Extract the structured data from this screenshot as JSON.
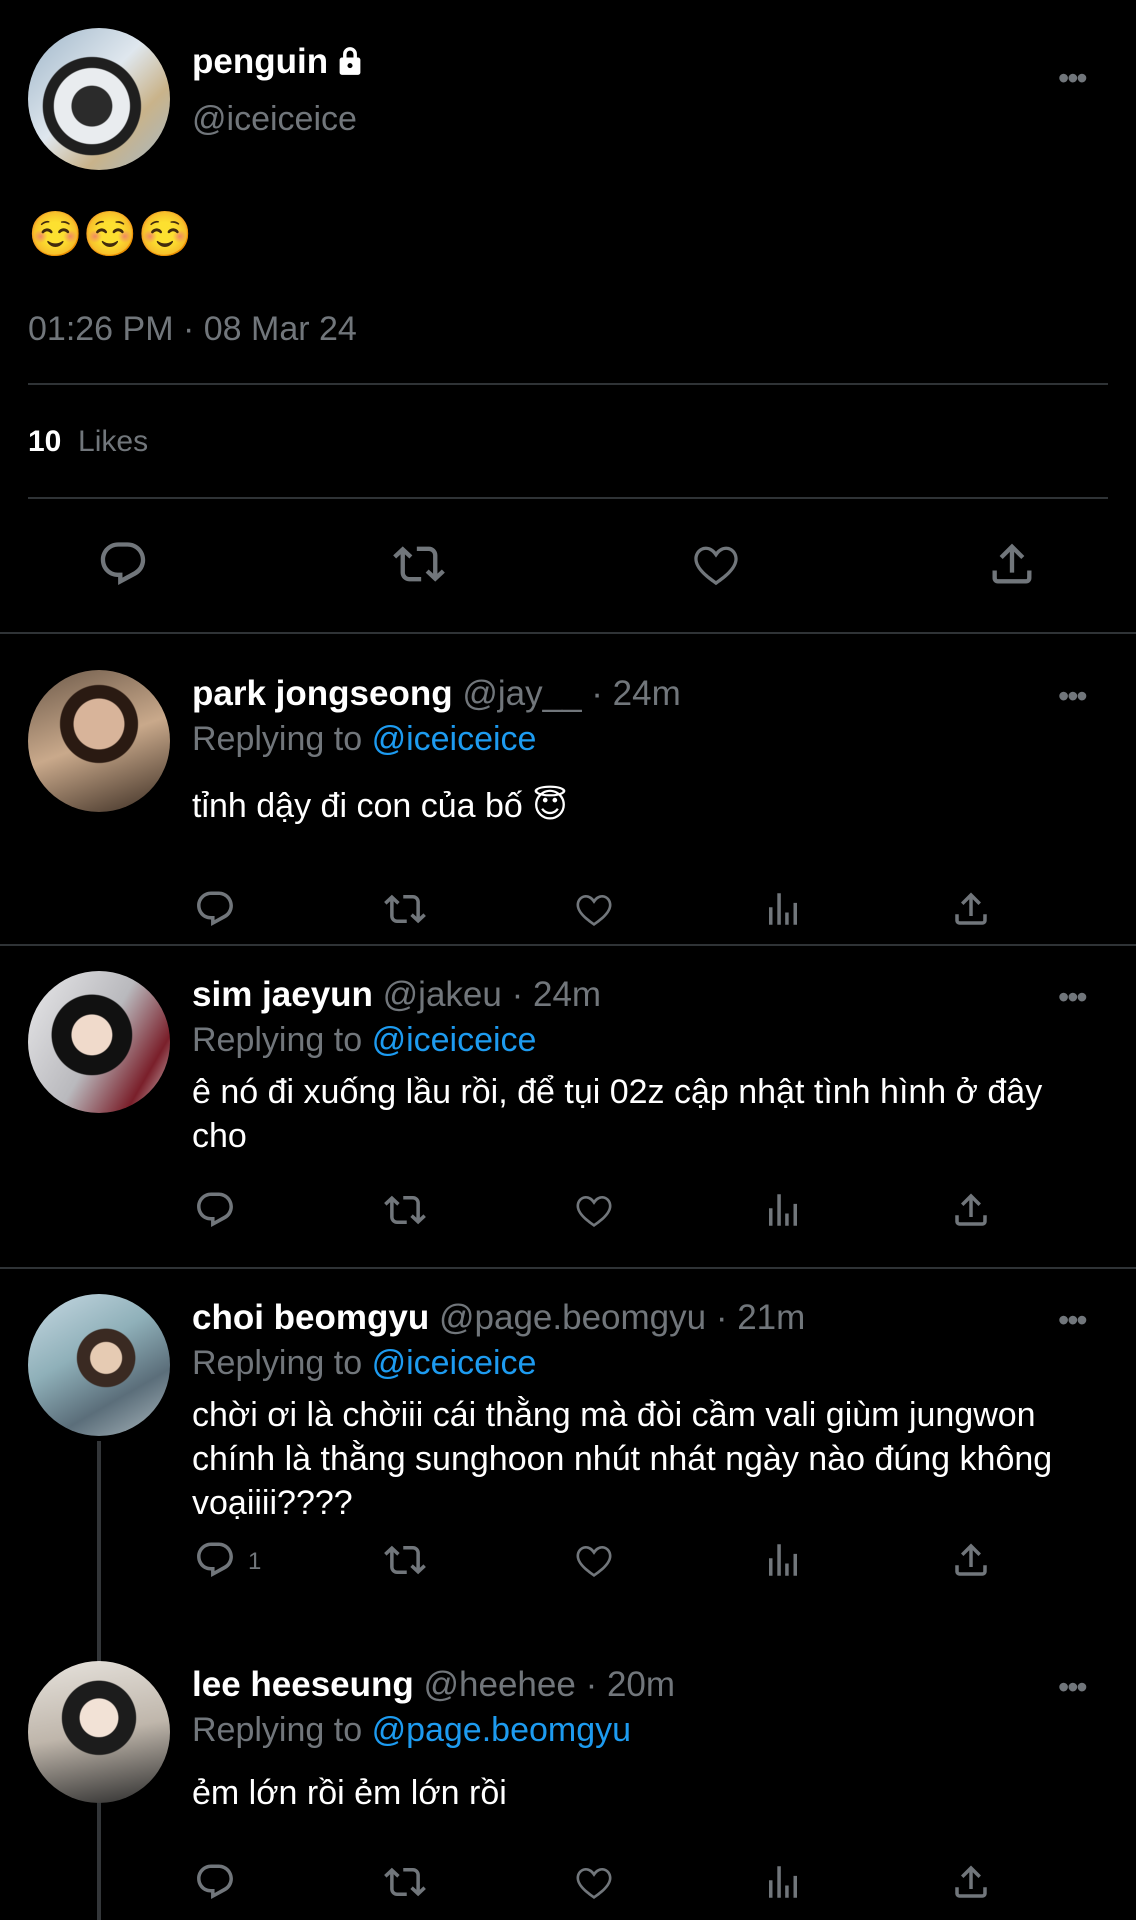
{
  "main": {
    "name": "penguin",
    "handle": "@iceiceice",
    "text": "☺️☺️☺️",
    "timestamp": "01:26 PM · 08 Mar 24",
    "likes_count": "10",
    "likes_label": "Likes",
    "more": "•••"
  },
  "replies": [
    {
      "name": "park jongseong",
      "handle": "@jay__",
      "time": "24m",
      "replying_prefix": "Replying to",
      "replying_to": "@iceiceice",
      "text": "tỉnh dậy đi con của bố 😇"
    },
    {
      "name": "sim jaeyun",
      "handle": "@jakeu",
      "time": "24m",
      "replying_prefix": "Replying to",
      "replying_to": "@iceiceice",
      "text": "ê nó đi xuống lầu rồi, để tụi 02z cập nhật tình hình ở đây cho"
    },
    {
      "name": "choi beomgyu",
      "handle": "@page.beomgyu",
      "time": "21m",
      "replying_prefix": "Replying to",
      "replying_to": "@iceiceice",
      "text": "chời ơi là chờiii cái thằng mà đòi cầm vali giùm jungwon chính là thằng sunghoon nhút nhát ngày nào đúng không voạiiii????",
      "reply_count": "1"
    },
    {
      "name": "lee heeseung",
      "handle": "@heehee",
      "time": "20m",
      "replying_prefix": "Replying to",
      "replying_to": "@page.beomgyu",
      "text": "ẻm lớn rồi ẻm lớn rồi"
    }
  ],
  "separator": "·",
  "icons": {
    "reply": "comment-icon",
    "retweet": "retweet-icon",
    "like": "heart-icon",
    "views": "views-chart-icon",
    "share": "share-icon",
    "lock": "lock-icon",
    "more": "more-dots-icon"
  }
}
